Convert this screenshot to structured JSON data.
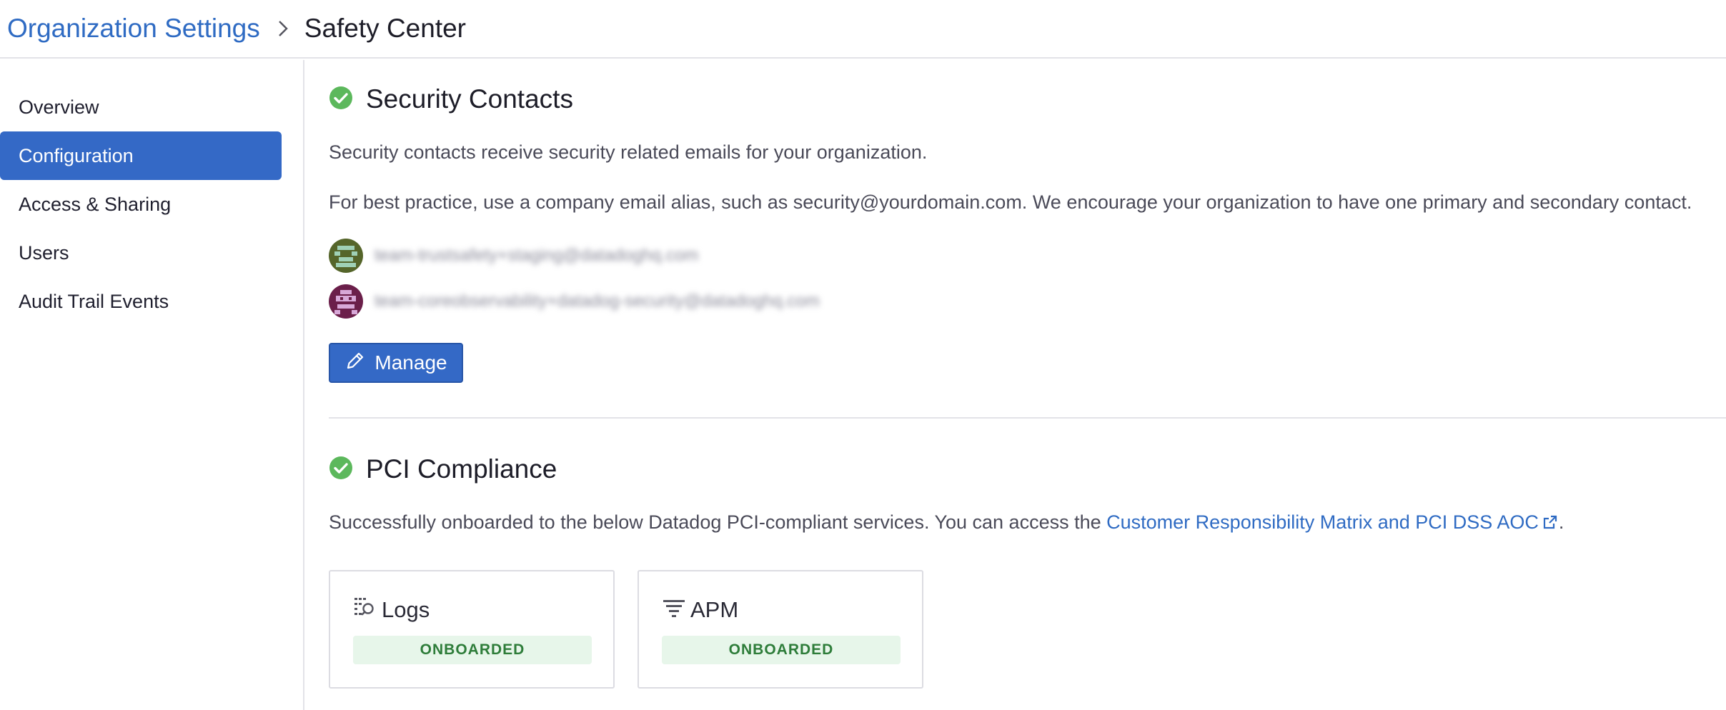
{
  "breadcrumb": {
    "parent": "Organization Settings",
    "current": "Safety Center"
  },
  "sidebar": {
    "items": [
      {
        "label": "Overview",
        "active": false
      },
      {
        "label": "Configuration",
        "active": true
      },
      {
        "label": "Access & Sharing",
        "active": false
      },
      {
        "label": "Users",
        "active": false
      },
      {
        "label": "Audit Trail Events",
        "active": false
      }
    ]
  },
  "security_contacts": {
    "title": "Security Contacts",
    "status_icon": "check-circle-icon",
    "description": "Security contacts receive security related emails for your organization.",
    "best_practice": "For best practice, use a company email alias, such as security@yourdomain.com. We encourage your organization to have one primary and secondary contact.",
    "contacts": [
      {
        "email": "team-trustsafety+staging@datadoghq.com",
        "avatar_color": "#5a6a2a"
      },
      {
        "email": "team-coreobservability+datadog-security@datadoghq.com",
        "avatar_color": "#6b1f4a"
      }
    ],
    "manage_label": "Manage"
  },
  "pci": {
    "title": "PCI Compliance",
    "status_icon": "check-circle-icon",
    "description_prefix": "Successfully onboarded to the below Datadog PCI-compliant services. You can access the ",
    "link_text": "Customer Responsibility Matrix and PCI DSS AOC",
    "description_suffix": ".",
    "services": [
      {
        "name": "Logs",
        "icon": "logs-search-icon",
        "status": "ONBOARDED"
      },
      {
        "name": "APM",
        "icon": "apm-trace-icon",
        "status": "ONBOARDED"
      }
    ]
  },
  "colors": {
    "accent": "#3469c6",
    "link": "#2f6bc3",
    "success": "#5cb85c",
    "badge_bg": "#e7f6ea",
    "badge_text": "#2e7d3a"
  }
}
